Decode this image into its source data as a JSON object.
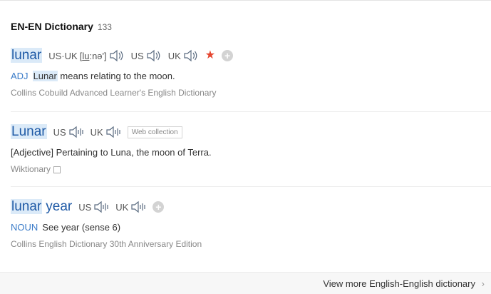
{
  "header": {
    "title": "EN-EN Dictionary",
    "count": "133"
  },
  "entries": [
    {
      "headword_hl": "lunar",
      "pron": [
        {
          "label": "US·UK",
          "ipa_pre": "[",
          "ipa_u": "lu",
          "ipa_post": ":nə']"
        },
        {
          "label": "US"
        },
        {
          "label": "UK"
        }
      ],
      "definition": {
        "pos": "ADJ",
        "hl": "Lunar",
        "text": " means relating to the moon."
      },
      "source": "Collins Cobuild Advanced Learner's English Dictionary"
    },
    {
      "headword_hl": "Lunar",
      "pron": [
        {
          "label": "US"
        },
        {
          "label": "UK"
        }
      ],
      "tag": "Web collection",
      "definition": {
        "text": "[Adjective] Pertaining to Luna, the moon of Terra."
      },
      "source": "Wiktionary"
    },
    {
      "headword_hl": "lunar",
      "headword_rest": "year",
      "pron": [
        {
          "label": "US"
        },
        {
          "label": "UK"
        }
      ],
      "definition": {
        "pos": "NOUN",
        "text": "See year (sense 6)"
      },
      "source": "Collins English Dictionary 30th Anniversary Edition"
    }
  ],
  "footer": {
    "more_label": "View more English-English dictionary",
    "chevron": "›"
  },
  "icons": {
    "speaker": "speaker-icon",
    "star": "star-icon",
    "add": "plus-circle-icon",
    "copy": "copy-icon"
  },
  "colors": {
    "headword": "#1f5aa6",
    "highlight": "#dbeaf8",
    "star": "#e5452f",
    "pos": "#3a7bc8"
  }
}
